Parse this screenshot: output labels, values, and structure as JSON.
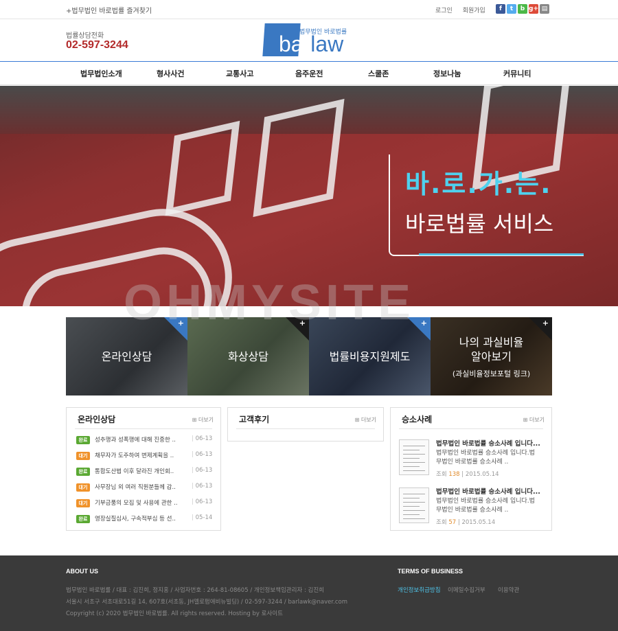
{
  "topbar": {
    "favorite": "+법무법인 바로법률 즐겨찾기",
    "login": "로그인",
    "join": "회원가입",
    "sns": [
      {
        "icon": "facebook-icon",
        "glyph": "f",
        "color": "#3b5998"
      },
      {
        "icon": "twitter-icon",
        "glyph": "t",
        "color": "#55acee"
      },
      {
        "icon": "band-icon",
        "glyph": "b",
        "color": "#4cb848"
      },
      {
        "icon": "google-plus-icon",
        "glyph": "g+",
        "color": "#dd4b39"
      },
      {
        "icon": "print-icon",
        "glyph": "▤",
        "color": "#888888"
      }
    ]
  },
  "header": {
    "tel_label": "법률상담전화",
    "tel": "02-597-3244",
    "logo_sub": "법무법인 바로법률",
    "logo_word_a": "bar",
    "logo_word_b": "law"
  },
  "nav": [
    "법무법인소개",
    "형사사건",
    "교통사고",
    "음주운전",
    "스쿨존",
    "정보나눔",
    "커뮤니티"
  ],
  "hero": {
    "line1": "바.로.가.는.",
    "line2": "바로법률 서비스",
    "watermark": "OHMYSITE"
  },
  "quick": [
    {
      "label": "온라인상담",
      "sub": ""
    },
    {
      "label": "화상상담",
      "sub": ""
    },
    {
      "label": "법률비용지원제도",
      "sub": ""
    },
    {
      "label": "나의 과실비율\n알아보기",
      "sub": "(과실비율정보포털 링크)"
    }
  ],
  "boards": {
    "more": "더보기",
    "online": {
      "title": "온라인상담",
      "rows": [
        {
          "status": "완료",
          "text": "성추행과 성폭행에 대해 진중한 ..",
          "date": "06-13"
        },
        {
          "status": "대기",
          "text": "채무자가 도주하여 변제계획을 ..",
          "date": "06-13"
        },
        {
          "status": "완료",
          "text": "통합도산법 이후 달라진 개인회..",
          "date": "06-13"
        },
        {
          "status": "대기",
          "text": "사무장님 외 여러 직원분들께 감..",
          "date": "06-13"
        },
        {
          "status": "대기",
          "text": "기부금품의 모집 및 사용에 관한 ..",
          "date": "06-13"
        },
        {
          "status": "완료",
          "text": "영장실질심사, 구속적부심 등 선..",
          "date": "05-14"
        }
      ]
    },
    "review": {
      "title": "고객후기"
    },
    "cases": {
      "title": "승소사례",
      "items": [
        {
          "title": "법무법인 바로법률 승소사례 입니다...",
          "desc": "법무법인 바로법률 승소사례 입니다.법무법인 바로법률 승소사례 ..",
          "views_label": "조회",
          "views": "138",
          "date": "2015.05.14"
        },
        {
          "title": "법무법인 바로법률 승소사례 입니다...",
          "desc": "법무법인 바로법률 승소사례 입니다.법무법인 바로법률 승소사례 ..",
          "views_label": "조회",
          "views": "57",
          "date": "2015.05.14"
        }
      ]
    }
  },
  "footer": {
    "about_title": "ABOUT US",
    "line1": "법무법인 바로법률 / 대표 : 김진희, 정지홍 / 사업자번호 : 264-81-08605 / 개인정보책임관리자 : 김진희",
    "line2": "서울시 서초구 서초대로51길 14, 607호(서초동, JH엘로펌애비뉴빌딩) / 02-597-3244 / barlawk@naver.com",
    "line3": "Copyright (c) 2020 법무법인 바로법률. All rights reserved. Hosting by 로사이트",
    "terms_title": "TERMS OF BUSINESS",
    "terms": [
      "개인정보취급방침",
      "이메일수집거부",
      "이용약관"
    ]
  },
  "colors": {
    "accent": "#3a78c2",
    "tel": "#b32a2a",
    "hero_text": "#4fd1ee",
    "done": "#5aa832",
    "wait": "#f0922a",
    "footer_bg": "#3a3a3a"
  }
}
